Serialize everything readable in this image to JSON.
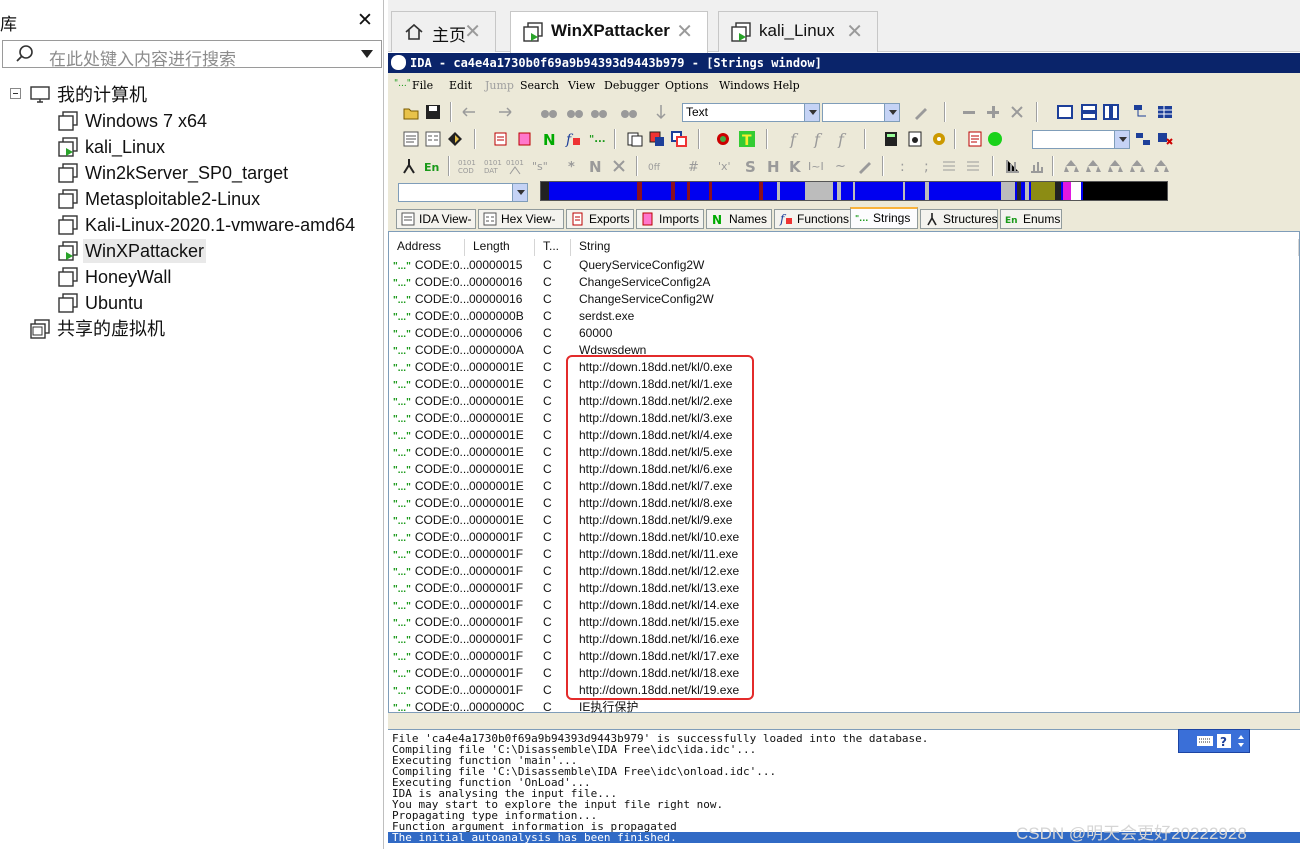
{
  "library": {
    "title": "库",
    "close_glyph": "✕",
    "search_placeholder": "在此处键入内容进行搜索",
    "items": [
      {
        "label": "我的计算机",
        "icon": "computer-icon"
      },
      {
        "label": "Windows 7 x64",
        "icon": "vm-icon"
      },
      {
        "label": "kali_Linux",
        "icon": "vm-running-icon"
      },
      {
        "label": "Win2kServer_SP0_target",
        "icon": "vm-icon"
      },
      {
        "label": "Metasploitable2-Linux",
        "icon": "vm-icon"
      },
      {
        "label": "Kali-Linux-2020.1-vmware-amd64",
        "icon": "vm-icon"
      },
      {
        "label": "WinXPattacker",
        "icon": "vm-running-icon"
      },
      {
        "label": "HoneyWall",
        "icon": "vm-icon"
      },
      {
        "label": "Ubuntu",
        "icon": "vm-icon"
      },
      {
        "label": "共享的虚拟机",
        "icon": "shared-vm-icon"
      }
    ]
  },
  "tabs": [
    {
      "label": "主页",
      "icon": "home-icon"
    },
    {
      "label": "WinXPattacker",
      "icon": "vm-running-icon",
      "active": true
    },
    {
      "label": "kali_Linux",
      "icon": "vm-running-icon"
    }
  ],
  "tab_close_glyph": "✕",
  "ida": {
    "title": "IDA - ca4e4a1730b0f69a9b94393d9443b979 - [Strings window]",
    "menu": [
      "File",
      "Edit",
      "Jump",
      "Search",
      "View",
      "Debugger",
      "Options",
      "Windows",
      "Help"
    ],
    "menu_prefix": "\"...\"",
    "text_combo": "Text",
    "view_tabs": [
      "IDA View-A",
      "Hex View-A",
      "Exports",
      "Imports",
      "Names",
      "Functions",
      "Strings",
      "Structures",
      "Enums"
    ],
    "columns": [
      "Address",
      "Length",
      "T...",
      "String"
    ],
    "rows": [
      {
        "addr": "CODE:0...",
        "len": "00000015",
        "type": "C",
        "str": "QueryServiceConfig2W"
      },
      {
        "addr": "CODE:0...",
        "len": "00000016",
        "type": "C",
        "str": "ChangeServiceConfig2A"
      },
      {
        "addr": "CODE:0...",
        "len": "00000016",
        "type": "C",
        "str": "ChangeServiceConfig2W"
      },
      {
        "addr": "CODE:0...",
        "len": "0000000B",
        "type": "C",
        "str": "serdst.exe"
      },
      {
        "addr": "CODE:0...",
        "len": "00000006",
        "type": "C",
        "str": "60000"
      },
      {
        "addr": "CODE:0...",
        "len": "0000000A",
        "type": "C",
        "str": "Wdswsdewn"
      },
      {
        "addr": "CODE:0...",
        "len": "0000001E",
        "type": "C",
        "str": "http://down.18dd.net/kl/0.exe"
      },
      {
        "addr": "CODE:0...",
        "len": "0000001E",
        "type": "C",
        "str": "http://down.18dd.net/kl/1.exe"
      },
      {
        "addr": "CODE:0...",
        "len": "0000001E",
        "type": "C",
        "str": "http://down.18dd.net/kl/2.exe"
      },
      {
        "addr": "CODE:0...",
        "len": "0000001E",
        "type": "C",
        "str": "http://down.18dd.net/kl/3.exe"
      },
      {
        "addr": "CODE:0...",
        "len": "0000001E",
        "type": "C",
        "str": "http://down.18dd.net/kl/4.exe"
      },
      {
        "addr": "CODE:0...",
        "len": "0000001E",
        "type": "C",
        "str": "http://down.18dd.net/kl/5.exe"
      },
      {
        "addr": "CODE:0...",
        "len": "0000001E",
        "type": "C",
        "str": "http://down.18dd.net/kl/6.exe"
      },
      {
        "addr": "CODE:0...",
        "len": "0000001E",
        "type": "C",
        "str": "http://down.18dd.net/kl/7.exe"
      },
      {
        "addr": "CODE:0...",
        "len": "0000001E",
        "type": "C",
        "str": "http://down.18dd.net/kl/8.exe"
      },
      {
        "addr": "CODE:0...",
        "len": "0000001E",
        "type": "C",
        "str": "http://down.18dd.net/kl/9.exe"
      },
      {
        "addr": "CODE:0...",
        "len": "0000001F",
        "type": "C",
        "str": "http://down.18dd.net/kl/10.exe"
      },
      {
        "addr": "CODE:0...",
        "len": "0000001F",
        "type": "C",
        "str": "http://down.18dd.net/kl/11.exe"
      },
      {
        "addr": "CODE:0...",
        "len": "0000001F",
        "type": "C",
        "str": "http://down.18dd.net/kl/12.exe"
      },
      {
        "addr": "CODE:0...",
        "len": "0000001F",
        "type": "C",
        "str": "http://down.18dd.net/kl/13.exe"
      },
      {
        "addr": "CODE:0...",
        "len": "0000001F",
        "type": "C",
        "str": "http://down.18dd.net/kl/14.exe"
      },
      {
        "addr": "CODE:0...",
        "len": "0000001F",
        "type": "C",
        "str": "http://down.18dd.net/kl/15.exe"
      },
      {
        "addr": "CODE:0...",
        "len": "0000001F",
        "type": "C",
        "str": "http://down.18dd.net/kl/16.exe"
      },
      {
        "addr": "CODE:0...",
        "len": "0000001F",
        "type": "C",
        "str": "http://down.18dd.net/kl/17.exe"
      },
      {
        "addr": "CODE:0...",
        "len": "0000001F",
        "type": "C",
        "str": "http://down.18dd.net/kl/18.exe"
      },
      {
        "addr": "CODE:0...",
        "len": "0000001F",
        "type": "C",
        "str": "http://down.18dd.net/kl/19.exe"
      },
      {
        "addr": "CODE:0...",
        "len": "0000000C",
        "type": "C",
        "str": "IE执行保护"
      }
    ],
    "output": [
      "File 'ca4e4a1730b0f69a9b94393d9443b979' is successfully loaded into the database.",
      "Compiling file 'C:\\Disassemble\\IDA Free\\idc\\ida.idc'...",
      "Executing function 'main'...",
      "Compiling file 'C:\\Disassemble\\IDA Free\\idc\\onload.idc'...",
      "Executing function 'OnLoad'...",
      "IDA is analysing the input file...",
      "You may start to explore the input file right now.",
      "Propagating type information...",
      "Function argument information is propagated",
      "The initial autoanalysis has been finished."
    ],
    "colors": {
      "title_bar": "#0a246a",
      "navbar_code": "#0000f0",
      "highlight_box": "#e32b2b",
      "selected_output": "#316ac5"
    }
  },
  "watermark": "CSDN @明天会更好20222928"
}
